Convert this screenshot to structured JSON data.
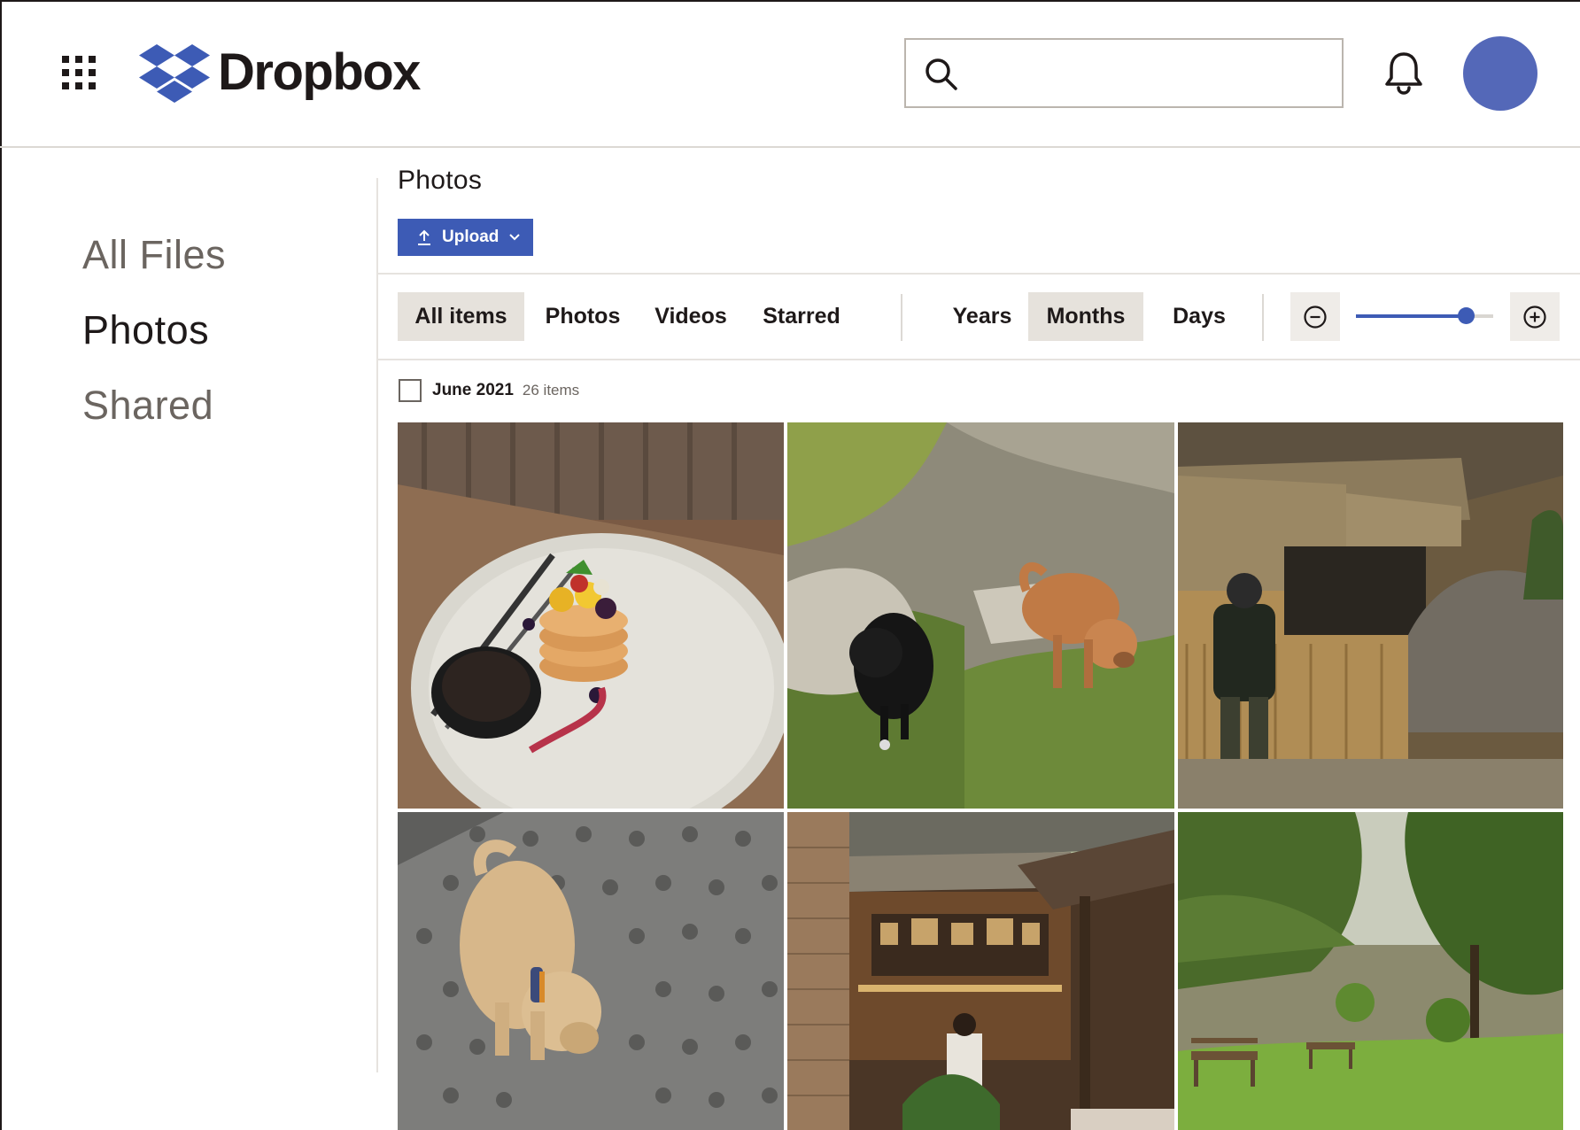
{
  "header": {
    "logo_text": "Dropbox",
    "search_placeholder": ""
  },
  "icons": {
    "app_grid": "grid-icon",
    "logo": "dropbox-logo",
    "search": "search-icon",
    "bell": "bell-icon",
    "upload": "upload-icon",
    "chevron": "chevron-down-icon",
    "zoom_out": "zoom-out-icon",
    "zoom_in": "zoom-in-icon"
  },
  "colors": {
    "brand": "#3d5bb5",
    "avatar": "#5468b8",
    "active_tab_bg": "#e6e2dc"
  },
  "sidebar": {
    "items": [
      {
        "label": "All Files",
        "active": false
      },
      {
        "label": "Photos",
        "active": true
      },
      {
        "label": "Shared",
        "active": false
      }
    ]
  },
  "main": {
    "title": "Photos",
    "upload_label": "Upload",
    "filters": [
      {
        "label": "All items",
        "active": true
      },
      {
        "label": "Photos",
        "active": false
      },
      {
        "label": "Videos",
        "active": false
      },
      {
        "label": "Starred",
        "active": false
      }
    ],
    "periods": [
      {
        "label": "Years",
        "active": false
      },
      {
        "label": "Months",
        "active": true
      },
      {
        "label": "Days",
        "active": false
      }
    ],
    "zoom_level": 0.8,
    "group": {
      "date": "June 2021",
      "count": "26 items",
      "checked": false
    },
    "photos": [
      {
        "subject": "pancakes-with-fruit"
      },
      {
        "subject": "two-puppies-on-grass"
      },
      {
        "subject": "thatched-roof-market-stall"
      },
      {
        "subject": "small-dog-on-paving"
      },
      {
        "subject": "rustic-cafe-interior"
      },
      {
        "subject": "riverside-park-benches"
      }
    ]
  }
}
